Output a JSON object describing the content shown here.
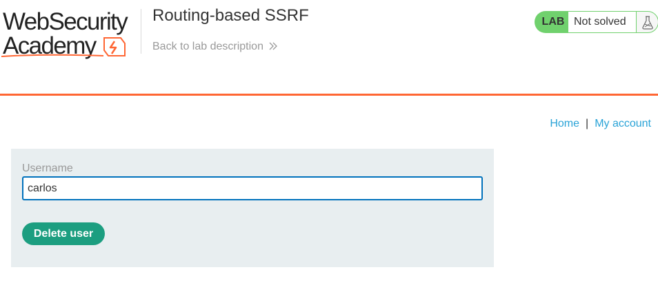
{
  "header": {
    "logo": {
      "line1": "WebSecurity",
      "line2": "Academy"
    },
    "lab_title": "Routing-based SSRF",
    "back_link": "Back to lab description",
    "status": {
      "badge": "LAB",
      "text": "Not solved"
    }
  },
  "nav": {
    "home": "Home",
    "separator": "|",
    "my_account": "My account"
  },
  "form": {
    "username_label": "Username",
    "username_value": "carlos",
    "submit_label": "Delete user"
  },
  "colors": {
    "accent_orange": "#ff6633",
    "lab_green": "#70d16d",
    "button_green": "#1c9e80",
    "link_blue": "#29a3d7",
    "input_border": "#0071bc",
    "panel_bg": "#e8eef0"
  },
  "icons": [
    "websecurity-academy-logo",
    "chevron-double-right-icon",
    "flask-icon"
  ]
}
